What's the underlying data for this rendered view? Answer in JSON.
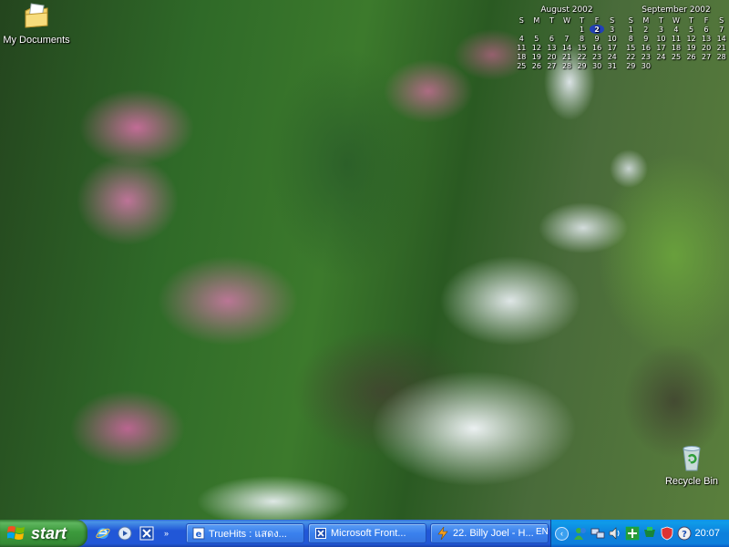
{
  "desktop": {
    "wallpaper": "waterfall-with-pink-azaleas",
    "icons": [
      {
        "label": "My Documents",
        "icon": "my-documents-icon"
      },
      {
        "label": "Recycle Bin",
        "icon": "recycle-bin-icon"
      }
    ],
    "calendars": [
      {
        "title": "August 2002",
        "weekday_headers": [
          "S",
          "M",
          "T",
          "W",
          "T",
          "F",
          "S"
        ],
        "weeks": [
          [
            "",
            "",
            "",
            "",
            "1",
            "2",
            "3"
          ],
          [
            "4",
            "5",
            "6",
            "7",
            "8",
            "9",
            "10"
          ],
          [
            "11",
            "12",
            "13",
            "14",
            "15",
            "16",
            "17"
          ],
          [
            "18",
            "19",
            "20",
            "21",
            "22",
            "23",
            "24"
          ],
          [
            "25",
            "26",
            "27",
            "28",
            "29",
            "30",
            "31"
          ]
        ],
        "highlighted_day": "2"
      },
      {
        "title": "September 2002",
        "weekday_headers": [
          "S",
          "M",
          "T",
          "W",
          "T",
          "F",
          "S"
        ],
        "weeks": [
          [
            "1",
            "2",
            "3",
            "4",
            "5",
            "6",
            "7"
          ],
          [
            "8",
            "9",
            "10",
            "11",
            "12",
            "13",
            "14"
          ],
          [
            "15",
            "16",
            "17",
            "18",
            "19",
            "20",
            "21"
          ],
          [
            "22",
            "23",
            "24",
            "25",
            "26",
            "27",
            "28"
          ],
          [
            "29",
            "30",
            "",
            "",
            "",
            "",
            ""
          ]
        ]
      }
    ]
  },
  "taskbar": {
    "start_label": "start",
    "quick_launch": [
      {
        "icon": "internet-explorer-icon"
      },
      {
        "icon": "media-player-icon"
      },
      {
        "icon": "frontpage-icon"
      }
    ],
    "quick_launch_more": "»",
    "tasks": [
      {
        "label": "TrueHits : แสดง...",
        "icon": "internet-explorer-page-icon"
      },
      {
        "label": "Microsoft Front...",
        "icon": "frontpage-icon"
      },
      {
        "label": "22. Billy Joel - H...",
        "icon": "winamp-icon"
      }
    ],
    "tray": {
      "language": "EN",
      "expand_arrow": "‹",
      "icons": [
        "msn-messenger-icon",
        "network-icon",
        "volume-icon",
        "antivirus-icon",
        "program-icon",
        "shield-icon",
        "help-icon"
      ],
      "clock": "20:07"
    }
  },
  "colors": {
    "taskbar_blue": "#2157d7",
    "start_green": "#3c9a3c",
    "tray_blue": "#0d80dc",
    "task_button": "#3a81ee"
  }
}
